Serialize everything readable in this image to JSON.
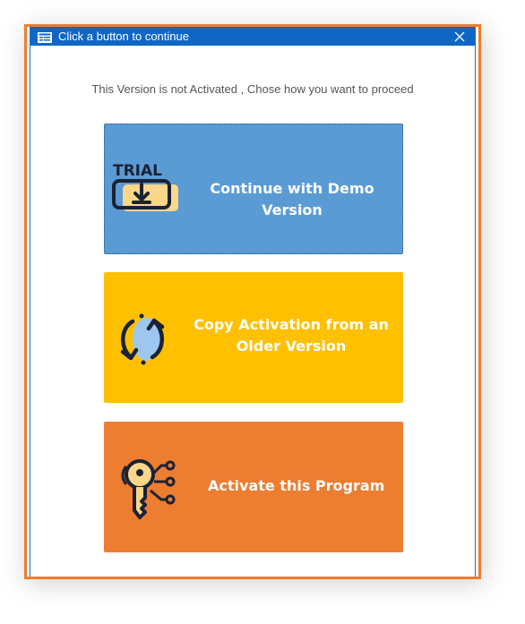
{
  "window": {
    "title": "Click a button to continue",
    "title_bar_color": "#0f66c4",
    "close_icon": "close-icon",
    "app_icon": "form-icon"
  },
  "message": "This Version is not Activated , Chose how you want to proceed",
  "buttons": [
    {
      "id": "demo",
      "label": "Continue with Demo Version",
      "icon": "trial-download-icon",
      "icon_text": "TRIAL",
      "color": "#5b9bd5"
    },
    {
      "id": "copy",
      "label_line1": "Copy Activation from an",
      "label_line2": "Older Version",
      "icon": "sync-icon",
      "color": "#ffc000"
    },
    {
      "id": "activate",
      "label": "Activate this Program",
      "icon": "digital-key-icon",
      "color": "#ed7d31"
    }
  ]
}
